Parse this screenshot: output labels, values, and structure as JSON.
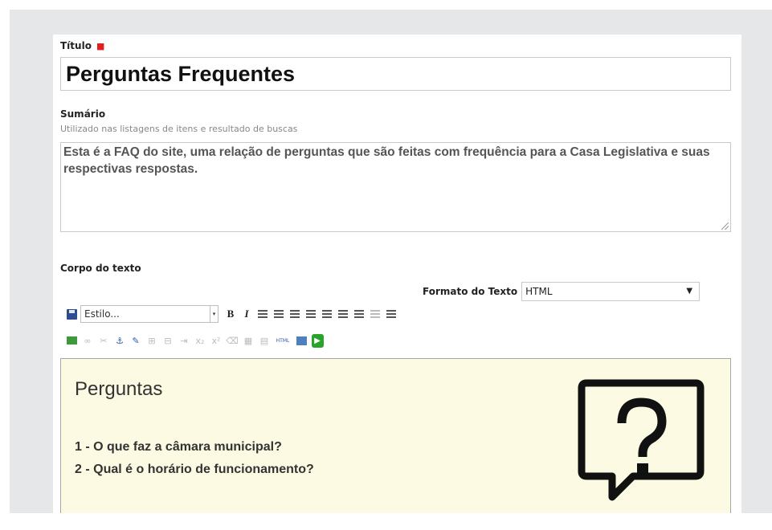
{
  "titulo": {
    "label": "Título",
    "required_mark": "■",
    "value": "Perguntas Frequentes"
  },
  "sumario": {
    "label": "Sumário",
    "hint": "Utilizado nas listagens de itens e resultado de buscas",
    "value": "Esta é a FAQ do site, uma relação de perguntas que são feitas com frequência para a Casa Legislativa e suas respectivas respostas."
  },
  "corpo": {
    "label": "Corpo do texto",
    "format_label": "Formato do Texto",
    "format_value": "HTML",
    "format_arrow": "▼"
  },
  "toolbar": {
    "style_placeholder": "Estilo...",
    "bold": "B",
    "italic": "I",
    "html_button": "HTML"
  },
  "editor": {
    "heading": "Perguntas",
    "questions": [
      "1 - O que faz a câmara municipal?",
      "2 - Qual é o horário de funcionamento?"
    ],
    "image_icon": "question-speech-bubble-icon"
  },
  "colors": {
    "frame_bg": "#e6e7e8",
    "editor_bg": "#fdfae3",
    "required": "#e02020"
  }
}
